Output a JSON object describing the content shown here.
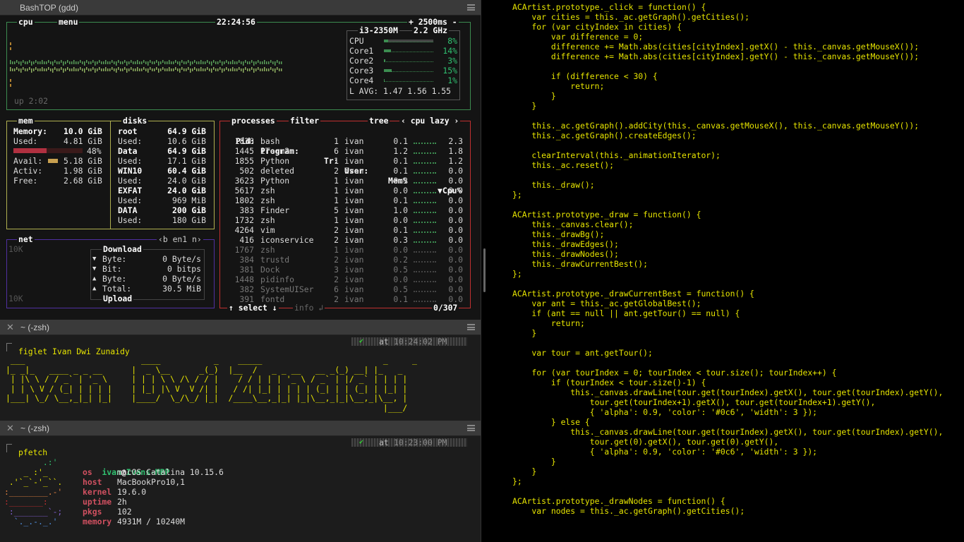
{
  "bashtop": {
    "window_title": "BashTOP (gdd)",
    "cpu_label": "cpu",
    "menu_label": "menu",
    "clock": "22:24:56",
    "update": "+ 2500ms -",
    "cpu_model": "i3-2350M",
    "cpu_freq": "2.2 GHz",
    "uptime": "up 2:02",
    "cores": [
      {
        "name": "CPU",
        "pct": "8%",
        "fill": 0.08
      },
      {
        "name": "Core1",
        "pct": "14%",
        "fill": 0.14
      },
      {
        "name": "Core2",
        "pct": "3%",
        "fill": 0.03
      },
      {
        "name": "Core3",
        "pct": "15%",
        "fill": 0.15
      },
      {
        "name": "Core4",
        "pct": "1%",
        "fill": 0.01
      }
    ],
    "load_avg": "L AVG: 1.47 1.56 1.55",
    "mem": {
      "label": "mem",
      "memory": "Memory:",
      "memory_val": "10.0 GiB",
      "used": "Used:",
      "used_val": "4.81 GiB",
      "used_pct": "48%",
      "used_fill": 0.48,
      "avail": "Avail:",
      "avail_val": "5.18 GiB",
      "activ": "Activ:",
      "activ_val": "1.98 GiB",
      "free": "Free:",
      "free_val": "2.68 GiB"
    },
    "disks": {
      "label": "disks",
      "items": [
        {
          "name": "root",
          "size": "64.9 GiB",
          "used": "10.6 GiB"
        },
        {
          "name": "Data",
          "size": "64.9 GiB",
          "used": "17.1 GiB"
        },
        {
          "name": "WIN10",
          "size": "60.4 GiB",
          "used": "24.0 GiB"
        },
        {
          "name": "EXFAT",
          "size": "24.0 GiB",
          "used": "969 MiB"
        },
        {
          "name": "DATA",
          "size": "200 GiB",
          "used": "180 GiB"
        }
      ],
      "used_label": "Used:"
    },
    "net": {
      "label": "net",
      "iface": "‹b en1 n›",
      "scale_top": "10K",
      "scale_bottom": "10K",
      "download": "Download",
      "upload": "Upload",
      "rows": [
        {
          "arrow": "▼",
          "name": "Byte:",
          "val": "0 Byte/s"
        },
        {
          "arrow": "▼",
          "name": "Bit:",
          "val": "0 bitps"
        },
        {
          "arrow": "▲",
          "name": "Byte:",
          "val": "0 Byte/s"
        },
        {
          "arrow": "▲",
          "name": "Total:",
          "val": "30.5 MiB"
        }
      ]
    },
    "proc": {
      "label": "processes",
      "filter": "filter",
      "tree": "tree",
      "sort": "‹ cpu lazy ›",
      "select": "↑ select ↓",
      "info": "info ↲",
      "count": "0/307",
      "headers": {
        "pid": "Pid:",
        "program": "Program:",
        "threads": "Tr:",
        "user": "User:",
        "mem": "Mem%",
        "cpu": "▼Cpu%"
      },
      "rows": [
        {
          "pid": "1838",
          "prog": "bash",
          "tr": "1",
          "user": "ivan",
          "mem": "0.1",
          "cpu": "2.3",
          "dim": false
        },
        {
          "pid": "1445",
          "prog": "iTerm2",
          "tr": "6",
          "user": "ivan",
          "mem": "1.2",
          "cpu": "1.8",
          "dim": false
        },
        {
          "pid": "1855",
          "prog": "Python",
          "tr": "1",
          "user": "ivan",
          "mem": "0.1",
          "cpu": "1.2",
          "dim": false
        },
        {
          "pid": "502",
          "prog": "deleted",
          "tr": "2",
          "user": "ivan",
          "mem": "0.1",
          "cpu": "0.0",
          "dim": false
        },
        {
          "pid": "3623",
          "prog": "Python",
          "tr": "1",
          "user": "ivan",
          "mem": "0.3",
          "cpu": "0.0",
          "dim": false
        },
        {
          "pid": "5617",
          "prog": "zsh",
          "tr": "1",
          "user": "ivan",
          "mem": "0.0",
          "cpu": "0.0",
          "dim": false
        },
        {
          "pid": "1802",
          "prog": "zsh",
          "tr": "1",
          "user": "ivan",
          "mem": "0.1",
          "cpu": "0.0",
          "dim": false
        },
        {
          "pid": "383",
          "prog": "Finder",
          "tr": "5",
          "user": "ivan",
          "mem": "1.0",
          "cpu": "0.0",
          "dim": false
        },
        {
          "pid": "1732",
          "prog": "zsh",
          "tr": "1",
          "user": "ivan",
          "mem": "0.0",
          "cpu": "0.0",
          "dim": false
        },
        {
          "pid": "4264",
          "prog": "vim",
          "tr": "2",
          "user": "ivan",
          "mem": "0.1",
          "cpu": "0.0",
          "dim": false
        },
        {
          "pid": "416",
          "prog": "iconservice",
          "tr": "2",
          "user": "ivan",
          "mem": "0.3",
          "cpu": "0.0",
          "dim": false
        },
        {
          "pid": "1767",
          "prog": "zsh",
          "tr": "1",
          "user": "ivan",
          "mem": "0.0",
          "cpu": "0.0",
          "dim": true
        },
        {
          "pid": "384",
          "prog": "trustd",
          "tr": "2",
          "user": "ivan",
          "mem": "0.2",
          "cpu": "0.0",
          "dim": true
        },
        {
          "pid": "381",
          "prog": "Dock",
          "tr": "3",
          "user": "ivan",
          "mem": "0.5",
          "cpu": "0.0",
          "dim": true
        },
        {
          "pid": "1448",
          "prog": "pidinfo",
          "tr": "2",
          "user": "ivan",
          "mem": "0.0",
          "cpu": "0.0",
          "dim": true
        },
        {
          "pid": "382",
          "prog": "SystemUISer",
          "tr": "6",
          "user": "ivan",
          "mem": "0.5",
          "cpu": "0.0",
          "dim": true
        },
        {
          "pid": "391",
          "prog": "fontd",
          "tr": "2",
          "user": "ivan",
          "mem": "0.1",
          "cpu": "0.0",
          "dim": true
        }
      ]
    }
  },
  "term1": {
    "title": "~ (-zsh)",
    "command": "figlet Ivan Dwi Zunaidy",
    "time_prefix": "at",
    "time": "10:24:02 PM",
    "figlet": [
      " ___                        ____           _    _____                         _     _        ",
      "|_ _|_   ____ _ _ __      |  _ \\__      _(_)  |__  /   _ _ __   __ _(_) __| |_   _ ",
      " | |\\ \\ / / _` | '_ \\     | | | \\ \\ /\\ / / |    / / | | | '_ \\ / _` | |/ _` | | | |",
      " | | \\ V / (_| | | | |    | |_| |\\ V  V /| |   / /| |_| | | | | (_| | | (_| | |_| |",
      "|___| \\_/ \\__,_|_| |_|    |____/  \\_/\\_/ |_|  /____\\__,_|_| |_|\\__,_|_|\\__,_|\\__, |",
      "                                                                              |___/ "
    ]
  },
  "term2": {
    "title": "~ (-zsh)",
    "command": "pfetch",
    "time_prefix": "at",
    "time": "10:23:00 PM",
    "user": "ivan",
    "at": "@",
    "host": "Ivans-MBP",
    "fields": [
      {
        "k": "os",
        "v": "macOS Catalina 10.15.6"
      },
      {
        "k": "host",
        "v": "MacBookPro10,1"
      },
      {
        "k": "kernel",
        "v": "19.6.0"
      },
      {
        "k": "uptime",
        "v": "2h"
      },
      {
        "k": "pkgs",
        "v": "102"
      },
      {
        "k": "memory",
        "v": "4931M / 10240M"
      }
    ],
    "logo": [
      "        .:'",
      "    _ :'_",
      " .'`_`-'_``.",
      ":________.-'",
      ":_______:",
      " :_______`-;",
      "  `._.-._.'"
    ]
  },
  "editor": {
    "lines": [
      "ACArtist.prototype._click = function() {",
      "    var cities = this._ac.getGraph().getCities();",
      "    for (var cityIndex in cities) {",
      "        var difference = 0;",
      "        difference += Math.abs(cities[cityIndex].getX() - this._canvas.getMouseX());",
      "        difference += Math.abs(cities[cityIndex].getY() - this._canvas.getMouseY());",
      "",
      "        if (difference < 30) {",
      "            return;",
      "        }",
      "    }",
      "",
      "    this._ac.getGraph().addCity(this._canvas.getMouseX(), this._canvas.getMouseY());",
      "    this._ac.getGraph().createEdges();",
      "",
      "    clearInterval(this._animationIterator);",
      "    this._ac.reset();",
      "",
      "    this._draw();",
      "};",
      "",
      "ACArtist.prototype._draw = function() {",
      "    this._canvas.clear();",
      "    this._drawBg();",
      "    this._drawEdges();",
      "    this._drawNodes();",
      "    this._drawCurrentBest();",
      "};",
      "",
      "ACArtist.prototype._drawCurrentBest = function() {",
      "    var ant = this._ac.getGlobalBest();",
      "    if (ant == null || ant.getTour() == null) {",
      "        return;",
      "    }",
      "",
      "    var tour = ant.getTour();",
      "",
      "    for (var tourIndex = 0; tourIndex < tour.size(); tourIndex++) {",
      "        if (tourIndex < tour.size()-1) {",
      "            this._canvas.drawLine(tour.get(tourIndex).getX(), tour.get(tourIndex).getY(),",
      "                tour.get(tourIndex+1).getX(), tour.get(tourIndex+1).getY(),",
      "                { 'alpha': 0.9, 'color': '#0c6', 'width': 3 });",
      "        } else {",
      "            this._canvas.drawLine(tour.get(tourIndex).getX(), tour.get(tourIndex).getY(),",
      "                tour.get(0).getX(), tour.get(0).getY(),",
      "                { 'alpha': 0.9, 'color': '#0c6', 'width': 3 });",
      "        }",
      "    }",
      "};",
      "",
      "ACArtist.prototype._drawNodes = function() {",
      "    var nodes = this._ac.getGraph().getCities();"
    ]
  },
  "colors": {
    "cpu_box": "#3c8c50",
    "mem_box": "#b0b050",
    "proc_box": "#c03030",
    "net_box": "#5030a0",
    "code": "#e6e400",
    "green": "#30c070"
  }
}
